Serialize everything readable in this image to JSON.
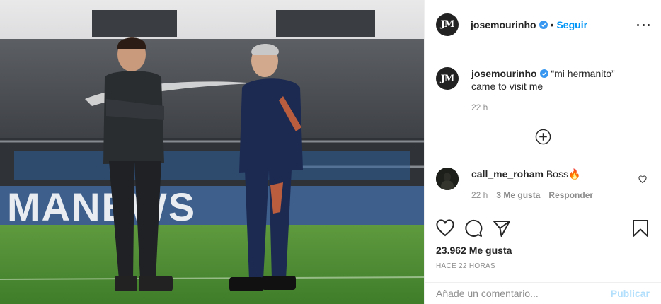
{
  "post": {
    "author": "josemourinho",
    "follow_label": "Seguir",
    "dot": "•",
    "caption": "“mi hermanito” came to visit me",
    "caption_time": "22 h",
    "likes": "23.962 Me gusta",
    "posted_ago": "HACE 22 HORAS",
    "photo_text": "MANEWS"
  },
  "comments": [
    {
      "user": "call_me_roham",
      "text": "Boss🔥",
      "time": "22 h",
      "likes": "3 Me gusta",
      "reply_label": "Responder"
    }
  ],
  "composer": {
    "placeholder": "Añade un comentario...",
    "publish_label": "Publicar"
  },
  "icons": {
    "avatar": "jm-logo-avatar",
    "verified": "verified-badge-icon",
    "more": "more-options-icon",
    "load_more": "plus-circle-icon",
    "like": "heart-icon",
    "comment": "comment-bubble-icon",
    "share": "paper-plane-icon",
    "save": "bookmark-icon"
  },
  "colors": {
    "accent": "#0095f6",
    "publish_disabled": "#b2dffc",
    "muted_text": "#8e8e8e",
    "verified": "#3897f0"
  }
}
